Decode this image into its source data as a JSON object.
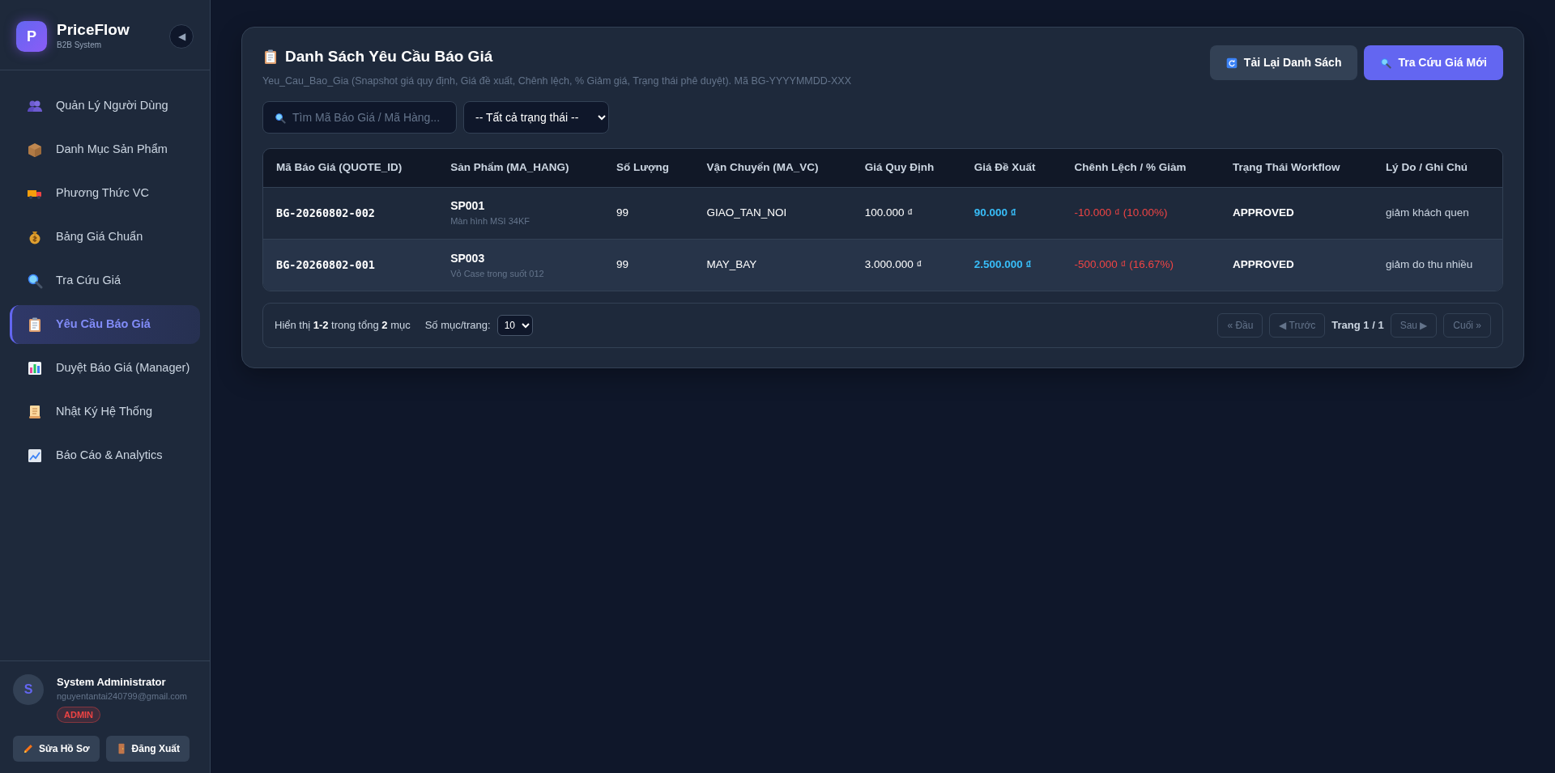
{
  "brand": {
    "logo": "P",
    "name": "PriceFlow",
    "tagline": "B2B System",
    "collapse": "◀"
  },
  "nav": [
    {
      "label": "Quản Lý Người Dùng",
      "selected": false
    },
    {
      "label": "Danh Mục Sản Phẩm",
      "selected": false
    },
    {
      "label": "Phương Thức VC",
      "selected": false
    },
    {
      "label": "Bảng Giá Chuẩn",
      "selected": false
    },
    {
      "label": "Tra Cứu Giá",
      "selected": false
    },
    {
      "label": "Yêu Cầu Báo Giá",
      "selected": true
    },
    {
      "label": "Duyệt Báo Giá (Manager)",
      "selected": false
    },
    {
      "label": "Nhật Ký Hệ Thống",
      "selected": false
    },
    {
      "label": "Báo Cáo & Analytics",
      "selected": false
    }
  ],
  "user": {
    "initial": "S",
    "name": "System Administrator",
    "email": "nguyentantai240799@gmail.com",
    "role": "ADMIN",
    "buttons": [
      "Sửa Hồ Sơ",
      "Đăng Xuất"
    ]
  },
  "page": {
    "title": "Danh Sách Yêu Cầu Báo Giá",
    "subtitle": "Yeu_Cau_Bao_Gia (Snapshot giá quy định, Giá đề xuất, Chênh lệch, % Giảm giá, Trạng thái phê duyệt). Mã BG-YYYYMMDD-XXX",
    "buttons": [
      {
        "label": "Tải Lại Danh Sách",
        "kind": "secondary"
      },
      {
        "label": "Tra Cứu Giá Mới",
        "kind": "primary"
      }
    ]
  },
  "filters": {
    "search": {
      "placeholder": "Tìm Mã Báo Giá / Mã Hàng..."
    },
    "status": {
      "value": "-- Tất cả trạng thái --"
    }
  },
  "table": {
    "columns": [
      "Mã Báo Giá (QUOTE_ID)",
      "Sản Phẩm (MA_HANG)",
      "Số Lượng",
      "Vận Chuyển (MA_VC)",
      "Giá Quy Định",
      "Giá Đề Xuất",
      "Chênh Lệch / % Giảm",
      "Trạng Thái Workflow",
      "Lý Do / Ghi Chú"
    ],
    "rows": [
      {
        "quote_id": "BG-20260802-002",
        "product_code": "SP001",
        "product_name": "Màn hình MSI 34KF",
        "quantity": "99",
        "shipping": "GIAO_TAN_NOI",
        "list_price": "100.000 ₫",
        "proposed_price": "90.000 ₫",
        "difference": "-10.000 ₫ (10.00%)",
        "status": "APPROVED",
        "note": "giảm khách quen"
      },
      {
        "quote_id": "BG-20260802-001",
        "product_code": "SP003",
        "product_name": "Vỏ Case trong suốt 012",
        "quantity": "99",
        "shipping": "MAY_BAY",
        "list_price": "3.000.000 ₫",
        "proposed_price": "2.500.000 ₫",
        "difference": "-500.000 ₫ (16.67%)",
        "status": "APPROVED",
        "note": "giảm do thu nhiều"
      }
    ]
  },
  "pagination": {
    "summary": "Hiển thị **1-2** trong tổng **2** mục",
    "per_page_label": "Số mục/trang:",
    "per_page": "10",
    "page_info": "Trang 1 / 1",
    "buttons": [
      {
        "label": "« Đầu",
        "disabled": true
      },
      {
        "label": "◀ Trước",
        "disabled": true
      },
      {
        "label": "Sau ▶",
        "disabled": true
      },
      {
        "label": "Cuối »",
        "disabled": true
      }
    ]
  }
}
